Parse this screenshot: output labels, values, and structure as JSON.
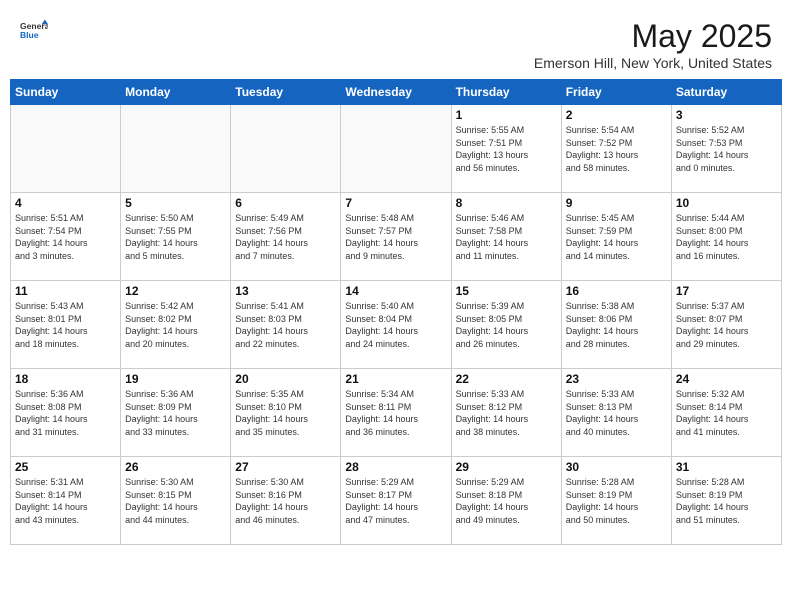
{
  "header": {
    "logo_general": "General",
    "logo_blue": "Blue",
    "title": "May 2025",
    "subtitle": "Emerson Hill, New York, United States"
  },
  "weekdays": [
    "Sunday",
    "Monday",
    "Tuesday",
    "Wednesday",
    "Thursday",
    "Friday",
    "Saturday"
  ],
  "weeks": [
    [
      {
        "day": "",
        "info": ""
      },
      {
        "day": "",
        "info": ""
      },
      {
        "day": "",
        "info": ""
      },
      {
        "day": "",
        "info": ""
      },
      {
        "day": "1",
        "info": "Sunrise: 5:55 AM\nSunset: 7:51 PM\nDaylight: 13 hours\nand 56 minutes."
      },
      {
        "day": "2",
        "info": "Sunrise: 5:54 AM\nSunset: 7:52 PM\nDaylight: 13 hours\nand 58 minutes."
      },
      {
        "day": "3",
        "info": "Sunrise: 5:52 AM\nSunset: 7:53 PM\nDaylight: 14 hours\nand 0 minutes."
      }
    ],
    [
      {
        "day": "4",
        "info": "Sunrise: 5:51 AM\nSunset: 7:54 PM\nDaylight: 14 hours\nand 3 minutes."
      },
      {
        "day": "5",
        "info": "Sunrise: 5:50 AM\nSunset: 7:55 PM\nDaylight: 14 hours\nand 5 minutes."
      },
      {
        "day": "6",
        "info": "Sunrise: 5:49 AM\nSunset: 7:56 PM\nDaylight: 14 hours\nand 7 minutes."
      },
      {
        "day": "7",
        "info": "Sunrise: 5:48 AM\nSunset: 7:57 PM\nDaylight: 14 hours\nand 9 minutes."
      },
      {
        "day": "8",
        "info": "Sunrise: 5:46 AM\nSunset: 7:58 PM\nDaylight: 14 hours\nand 11 minutes."
      },
      {
        "day": "9",
        "info": "Sunrise: 5:45 AM\nSunset: 7:59 PM\nDaylight: 14 hours\nand 14 minutes."
      },
      {
        "day": "10",
        "info": "Sunrise: 5:44 AM\nSunset: 8:00 PM\nDaylight: 14 hours\nand 16 minutes."
      }
    ],
    [
      {
        "day": "11",
        "info": "Sunrise: 5:43 AM\nSunset: 8:01 PM\nDaylight: 14 hours\nand 18 minutes."
      },
      {
        "day": "12",
        "info": "Sunrise: 5:42 AM\nSunset: 8:02 PM\nDaylight: 14 hours\nand 20 minutes."
      },
      {
        "day": "13",
        "info": "Sunrise: 5:41 AM\nSunset: 8:03 PM\nDaylight: 14 hours\nand 22 minutes."
      },
      {
        "day": "14",
        "info": "Sunrise: 5:40 AM\nSunset: 8:04 PM\nDaylight: 14 hours\nand 24 minutes."
      },
      {
        "day": "15",
        "info": "Sunrise: 5:39 AM\nSunset: 8:05 PM\nDaylight: 14 hours\nand 26 minutes."
      },
      {
        "day": "16",
        "info": "Sunrise: 5:38 AM\nSunset: 8:06 PM\nDaylight: 14 hours\nand 28 minutes."
      },
      {
        "day": "17",
        "info": "Sunrise: 5:37 AM\nSunset: 8:07 PM\nDaylight: 14 hours\nand 29 minutes."
      }
    ],
    [
      {
        "day": "18",
        "info": "Sunrise: 5:36 AM\nSunset: 8:08 PM\nDaylight: 14 hours\nand 31 minutes."
      },
      {
        "day": "19",
        "info": "Sunrise: 5:36 AM\nSunset: 8:09 PM\nDaylight: 14 hours\nand 33 minutes."
      },
      {
        "day": "20",
        "info": "Sunrise: 5:35 AM\nSunset: 8:10 PM\nDaylight: 14 hours\nand 35 minutes."
      },
      {
        "day": "21",
        "info": "Sunrise: 5:34 AM\nSunset: 8:11 PM\nDaylight: 14 hours\nand 36 minutes."
      },
      {
        "day": "22",
        "info": "Sunrise: 5:33 AM\nSunset: 8:12 PM\nDaylight: 14 hours\nand 38 minutes."
      },
      {
        "day": "23",
        "info": "Sunrise: 5:33 AM\nSunset: 8:13 PM\nDaylight: 14 hours\nand 40 minutes."
      },
      {
        "day": "24",
        "info": "Sunrise: 5:32 AM\nSunset: 8:14 PM\nDaylight: 14 hours\nand 41 minutes."
      }
    ],
    [
      {
        "day": "25",
        "info": "Sunrise: 5:31 AM\nSunset: 8:14 PM\nDaylight: 14 hours\nand 43 minutes."
      },
      {
        "day": "26",
        "info": "Sunrise: 5:30 AM\nSunset: 8:15 PM\nDaylight: 14 hours\nand 44 minutes."
      },
      {
        "day": "27",
        "info": "Sunrise: 5:30 AM\nSunset: 8:16 PM\nDaylight: 14 hours\nand 46 minutes."
      },
      {
        "day": "28",
        "info": "Sunrise: 5:29 AM\nSunset: 8:17 PM\nDaylight: 14 hours\nand 47 minutes."
      },
      {
        "day": "29",
        "info": "Sunrise: 5:29 AM\nSunset: 8:18 PM\nDaylight: 14 hours\nand 49 minutes."
      },
      {
        "day": "30",
        "info": "Sunrise: 5:28 AM\nSunset: 8:19 PM\nDaylight: 14 hours\nand 50 minutes."
      },
      {
        "day": "31",
        "info": "Sunrise: 5:28 AM\nSunset: 8:19 PM\nDaylight: 14 hours\nand 51 minutes."
      }
    ]
  ]
}
